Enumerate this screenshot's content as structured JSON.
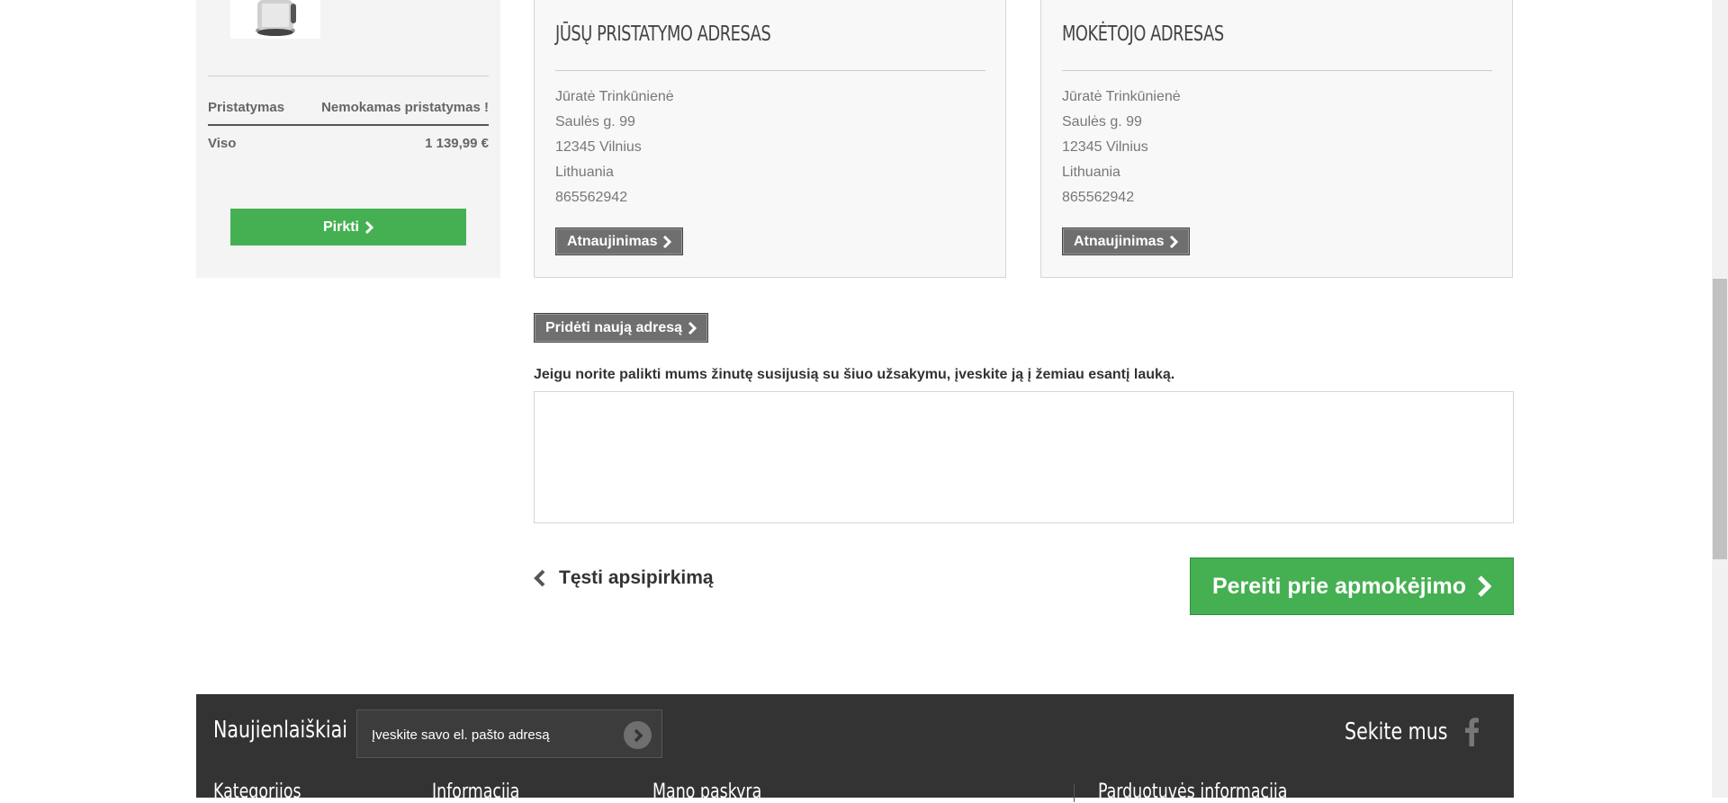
{
  "summary": {
    "shipping_label": "Pristatymas",
    "shipping_value": "Nemokamas pristatymas !",
    "total_label": "Viso",
    "total_value": "1 139,99 €",
    "buy_label": "Pirkti"
  },
  "delivery_address": {
    "title": "JŪSŲ PRISTATYMO ADRESAS",
    "name": "Jūratė Trinkūnienė",
    "street": "Saulės g. 99",
    "city": "12345 Vilnius",
    "country": "Lithuania",
    "phone": "865562942",
    "update_label": "Atnaujinimas"
  },
  "billing_address": {
    "title": "MOKĖTOJO ADRESAS",
    "name": "Jūratė Trinkūnienė",
    "street": "Saulės g. 99",
    "city": "12345 Vilnius",
    "country": "Lithuania",
    "phone": "865562942",
    "update_label": "Atnaujinimas"
  },
  "add_address_label": "Pridėti naują adresą",
  "message": {
    "label": "Jeigu norite palikti mums žinutę susijusią su šiuo užsakymu, įveskite ją į žemiau esantį lauką.",
    "value": ""
  },
  "nav": {
    "continue_label": "Tęsti apsipirkimą",
    "proceed_label": "Pereiti prie apmokėjimo"
  },
  "footer": {
    "newsletter_title": "Naujienlaiškiai",
    "newsletter_placeholder": "Įveskite savo el. pašto adresą",
    "follow_title": "Sekite mus",
    "columns": [
      "Kategorijos",
      "Informacija",
      "Mano paskyra",
      "Parduotuvės informacija"
    ]
  },
  "colors": {
    "green": "#45b052",
    "footer_bg": "#333333",
    "button_gray": "#6f6f6f"
  }
}
